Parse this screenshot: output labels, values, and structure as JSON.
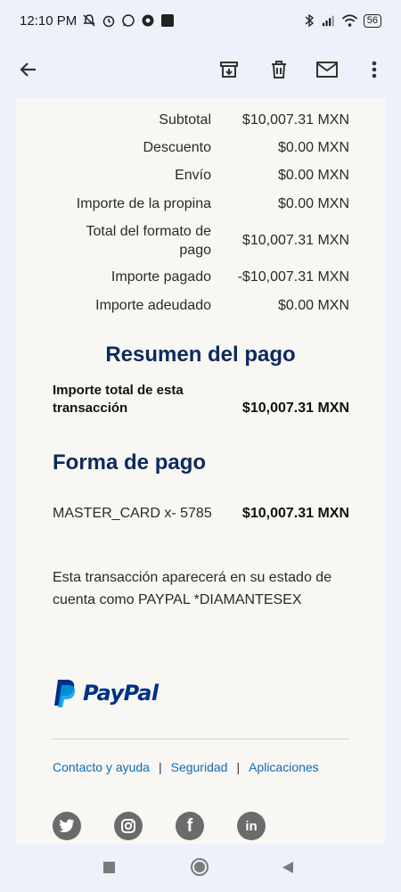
{
  "status": {
    "time": "12:10 PM",
    "battery": "56"
  },
  "toolbar": {
    "back_icon": "back-arrow-icon",
    "archive_icon": "archive-icon",
    "delete_icon": "trash-icon",
    "mail_icon": "mail-icon",
    "more_icon": "more-vert-icon"
  },
  "summary_rows": [
    {
      "label": "Subtotal",
      "value": "$10,007.31 MXN"
    },
    {
      "label": "Descuento",
      "value": "$0.00 MXN"
    },
    {
      "label": "Envío",
      "value": "$0.00 MXN"
    },
    {
      "label": "Importe de la propina",
      "value": "$0.00 MXN"
    },
    {
      "label_line1": "Total del formato de",
      "label_line2": "pago",
      "value": "$10,007.31 MXN"
    },
    {
      "label": "Importe pagado",
      "value": "-$10,007.31 MXN"
    },
    {
      "label": "Importe adeudado",
      "value": "$0.00 MXN"
    }
  ],
  "payment_summary": {
    "title": "Resumen del pago",
    "label_line1": "Importe total de esta",
    "label_line2": "transacción",
    "value": "$10,007.31 MXN"
  },
  "payment_method": {
    "title": "Forma de pago",
    "card": "MASTER_CARD x- 5785",
    "value": "$10,007.31 MXN"
  },
  "statement_note": {
    "line1": "Esta transacción aparecerá en su estado de",
    "line2": "cuenta como PAYPAL *DIAMANTESEX"
  },
  "brand": {
    "name": "PayPal",
    "color_dark": "#003087",
    "color_light": "#009cde"
  },
  "footer_links": [
    "Contacto y ayuda",
    "Seguridad",
    "Aplicaciones"
  ],
  "footer_sep": "|",
  "social_icons": [
    "twitter-icon",
    "instagram-icon",
    "facebook-icon",
    "linkedin-icon"
  ],
  "social_glyphs": {
    "facebook": "f",
    "linkedin": "in"
  }
}
